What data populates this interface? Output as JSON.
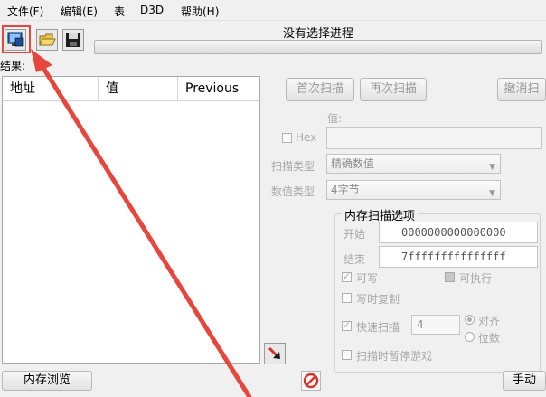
{
  "menu": {
    "file": "文件(F)",
    "edit": "编辑(E)",
    "table": "表",
    "d3d": "D3D",
    "help": "帮助(H)"
  },
  "process_label": "没有选择进程",
  "results_label": "结果:",
  "columns": [
    "地址",
    "值",
    "Previous"
  ],
  "buttons": {
    "first_scan": "首次扫描",
    "next_scan": "再次扫描",
    "undo_scan": "撤消扫",
    "memory_view": "内存浏览",
    "manual_add": "手动"
  },
  "value_label": "值:",
  "hex_label": "Hex",
  "scan_type_label": "扫描类型",
  "scan_type_value": "精确数值",
  "value_type_label": "数值类型",
  "value_type_value": "4字节",
  "mem_options": {
    "title": "内存扫描选项",
    "start_label": "开始",
    "start_value": "0000000000000000",
    "stop_label": "结束",
    "stop_value": "7fffffffffffffff",
    "writable": "可写",
    "executable": "可执行",
    "copy_on_write": "写时复制",
    "fast_scan": "快速扫描",
    "fast_scan_value": "4",
    "align": "对齐",
    "last_digits": "位数",
    "pause_game": "扫描时暂停游戏"
  },
  "colors": {
    "annotation": "#e8463c",
    "stop_icon": "#d9302a"
  },
  "icons": [
    "open-process-icon",
    "open-file-icon",
    "save-icon",
    "arrow-down-icon",
    "stop-icon"
  ]
}
